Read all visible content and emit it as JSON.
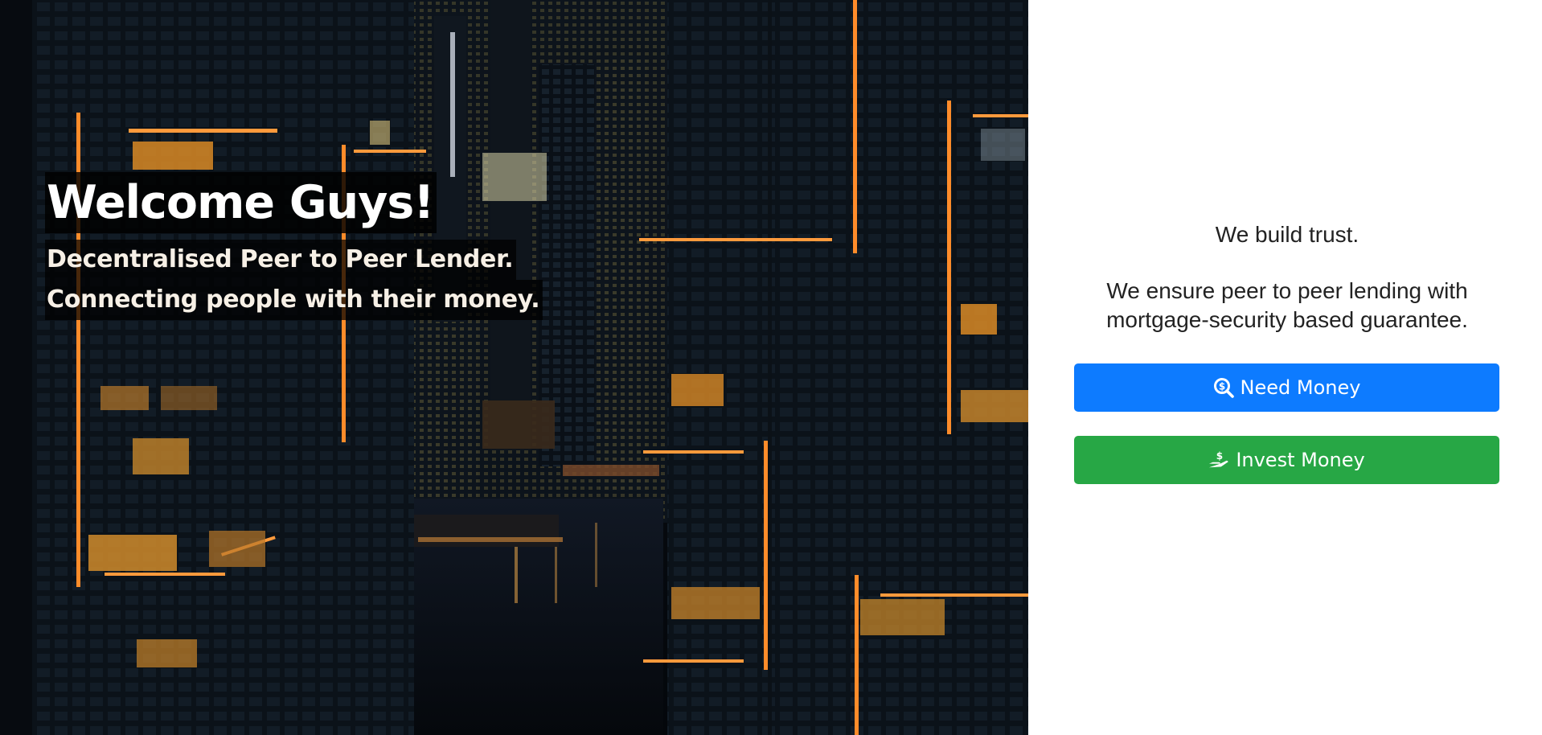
{
  "hero": {
    "title": "Welcome Guys!",
    "subtitle_line1": "Decentralised Peer to Peer Lender.",
    "subtitle_line2": "Connecting people with their money."
  },
  "panel": {
    "trust_text": "We build trust.",
    "ensure_text": "We ensure peer to peer lending with mortgage-security based guarantee.",
    "need_button": {
      "label": "Need Money",
      "icon": "search-dollar-icon",
      "color": "#0d7bff"
    },
    "invest_button": {
      "label": "Invest Money",
      "icon": "hand-holding-usd-icon",
      "color": "#27a745"
    }
  },
  "colors": {
    "accent_light": "#ff9a3c",
    "background_dark": "#05080d"
  }
}
